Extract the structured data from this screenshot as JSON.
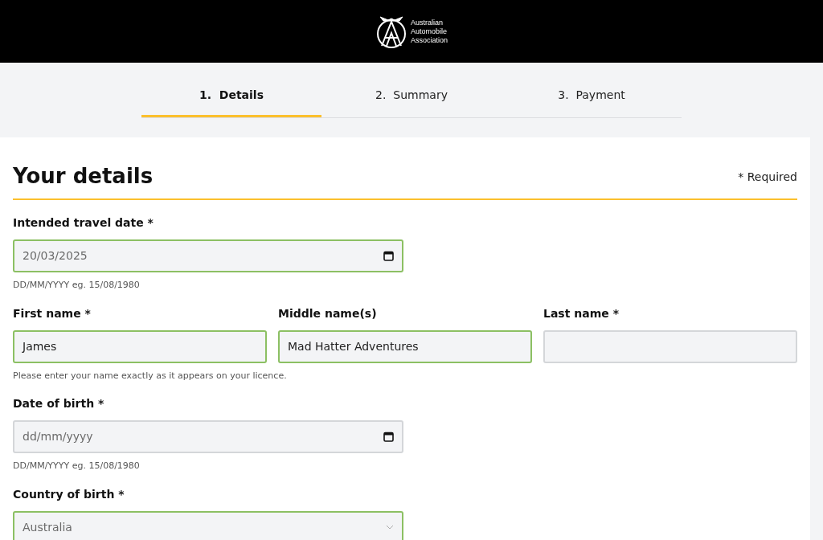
{
  "header": {
    "logo_text": [
      "Australian",
      "Automobile",
      "Association"
    ]
  },
  "steps": [
    {
      "label": "1.  Details",
      "selected": true
    },
    {
      "label": "2.  Summary",
      "selected": false
    },
    {
      "label": "3.  Payment",
      "selected": false
    }
  ],
  "form": {
    "title": "Your details",
    "required_note": "* Required",
    "rows": [
      {
        "fields": [
          {
            "kind": "date",
            "label": "Intended travel date *",
            "value": "20/03/2025",
            "valid": true
          }
        ],
        "hint": "DD/MM/YYYY eg. 15/08/1980"
      },
      {
        "fields": [
          {
            "kind": "text",
            "label": "First name *",
            "value": "James",
            "valid": true
          },
          {
            "kind": "text",
            "label": "Middle name(s)",
            "value": "Mad Hatter Adventures",
            "valid": true
          },
          {
            "kind": "text",
            "label": "Last name *",
            "valid": false
          }
        ],
        "hint": "Please enter your name exactly as it appears on your licence."
      },
      {
        "fields": [
          {
            "kind": "date",
            "label": "Date of birth *",
            "placeholder": "dd/mm/yyyy",
            "valid": false
          }
        ],
        "hint": "DD/MM/YYYY eg. 15/08/1980"
      },
      {
        "fields": [
          {
            "kind": "select",
            "label": "Country of birth *",
            "value": "Australia",
            "valid": true
          }
        ]
      }
    ]
  }
}
